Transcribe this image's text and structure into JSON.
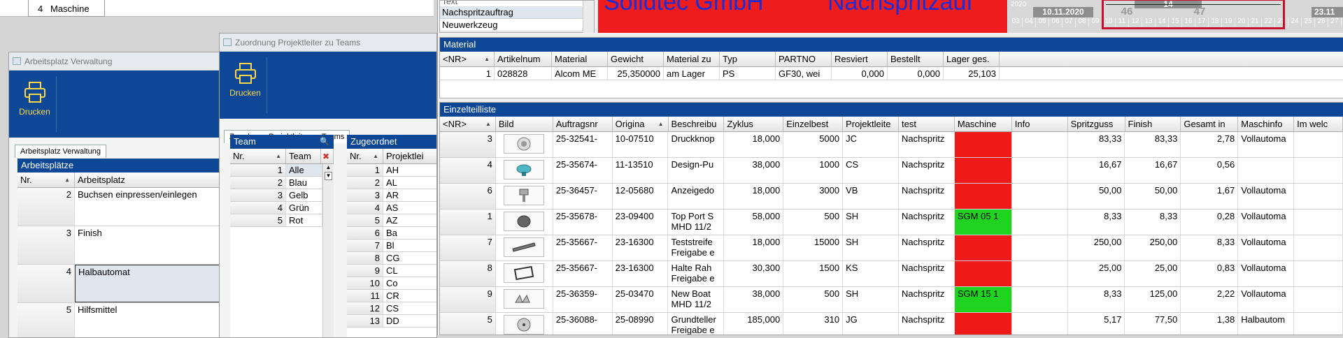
{
  "top_left": {
    "row_nr": "4",
    "row_label": "Maschine"
  },
  "win1": {
    "title": "Arbeitsplatz Verwaltung",
    "print_label": "Drucken",
    "tab": "Arbeitsplatz Verwaltung",
    "section": "Arbeitsplätze",
    "col_nr": "Nr.",
    "col_name": "Arbeitsplatz",
    "rows": [
      {
        "nr": "2",
        "name": "Buchsen einpressen/einlegen"
      },
      {
        "nr": "3",
        "name": "Finish"
      },
      {
        "nr": "4",
        "name": "Halbautomat"
      },
      {
        "nr": "5",
        "name": "Hilfsmittel"
      }
    ]
  },
  "win2": {
    "title": "Zuordnung Projektleiter zu Teams",
    "print_label": "Drucken",
    "tab": "Zuordnung Projektleiter zu Teams",
    "team_header": "Team",
    "assigned_header": "Zugeordnet",
    "col_nr": "Nr.",
    "col_team": "Team",
    "col_pl": "Projektlei",
    "teams": [
      {
        "nr": "1",
        "name": "Alle"
      },
      {
        "nr": "2",
        "name": "Blau"
      },
      {
        "nr": "3",
        "name": "Gelb"
      },
      {
        "nr": "4",
        "name": "Grün"
      },
      {
        "nr": "5",
        "name": "Rot"
      }
    ],
    "assigned": [
      {
        "nr": "1",
        "code": "AH"
      },
      {
        "nr": "2",
        "code": "AL"
      },
      {
        "nr": "3",
        "code": "AR"
      },
      {
        "nr": "4",
        "code": "AS"
      },
      {
        "nr": "5",
        "code": "AZ"
      },
      {
        "nr": "6",
        "code": "Ba"
      },
      {
        "nr": "7",
        "code": "Bl"
      },
      {
        "nr": "8",
        "code": "CG"
      },
      {
        "nr": "9",
        "code": "CL"
      },
      {
        "nr": "10",
        "code": "Co"
      },
      {
        "nr": "11",
        "code": "CR"
      },
      {
        "nr": "12",
        "code": "CS"
      },
      {
        "nr": "13",
        "code": "DD"
      }
    ]
  },
  "top": {
    "list_head": "Text",
    "list_items": [
      "Nachspritzauftrag",
      "Neuwerkzeug"
    ],
    "company": "Solidtec GmbH",
    "subject": "Nachspritzauf",
    "cal_year": "2020",
    "cal_date1": "10.11.2020",
    "cal_date2": "23.11",
    "cal_week1": "46",
    "cal_week2": "47",
    "cal_week_top": "14",
    "cal_days": [
      "03",
      "04",
      "05",
      "06",
      "07",
      "08",
      "09",
      "10",
      "11",
      "12",
      "13",
      "14",
      "15",
      "16",
      "17",
      "18",
      "19",
      "20",
      "21",
      "22",
      "23",
      "24",
      "25",
      "26",
      "27"
    ]
  },
  "material": {
    "title": "Material",
    "headers": [
      "<NR>",
      "Artikelnum",
      "Material",
      "Gewicht",
      "Material zu",
      "Typ",
      "PARTNO",
      "Resviert",
      "Bestellt",
      "Lager ges."
    ],
    "row": [
      "1",
      "028828",
      "Alcom ME",
      "25,350000",
      "am Lager",
      "PS",
      "GF30, wei",
      "0,000",
      "0,000",
      "25,103"
    ]
  },
  "parts": {
    "title": "Einzelteilliste",
    "headers": [
      "<NR>",
      "Bild",
      "Auftragsnr",
      "Origina",
      "Beschreibu",
      "Zyklus",
      "Einzelbest",
      "Projektleite",
      "test",
      "Maschine",
      "Info",
      "Spritzguss",
      "Finish",
      "Gesamt in",
      "Maschinfo",
      "Im welc"
    ],
    "rows": [
      {
        "nr": "3",
        "auftrag": "25-32541-",
        "orig": "10-07510",
        "desc1": "Druckknop",
        "desc2": "",
        "zyklus": "18,000",
        "einzel": "5000",
        "pl": "JC",
        "test": "Nachspritz",
        "maschine": "",
        "mcolor": "red",
        "spritz": "83,33",
        "finish": "83,33",
        "gesamt": "2,78",
        "minfo": "Vollautoma"
      },
      {
        "nr": "4",
        "auftrag": "25-35674-",
        "orig": "11-13510",
        "desc1": "Design-Pu",
        "desc2": "",
        "zyklus": "38,000",
        "einzel": "1000",
        "pl": "CS",
        "test": "Nachspritz",
        "maschine": "",
        "mcolor": "red",
        "spritz": "16,67",
        "finish": "16,67",
        "gesamt": "0,56",
        "minfo": ""
      },
      {
        "nr": "6",
        "auftrag": "25-36457-",
        "orig": "12-05680",
        "desc1": "Anzeigedo",
        "desc2": "",
        "zyklus": "18,000",
        "einzel": "3000",
        "pl": "VB",
        "test": "Nachspritz",
        "maschine": "",
        "mcolor": "red",
        "spritz": "50,00",
        "finish": "50,00",
        "gesamt": "1,67",
        "minfo": "Vollautoma"
      },
      {
        "nr": "1",
        "auftrag": "25-35678-",
        "orig": "23-09400",
        "desc1": "Top Port S",
        "desc2": "MHD 11/2",
        "zyklus": "58,000",
        "einzel": "500",
        "pl": "SH",
        "test": "Nachspritz",
        "maschine": "SGM 05  1",
        "mcolor": "green",
        "spritz": "8,33",
        "finish": "8,33",
        "gesamt": "0,28",
        "minfo": "Vollautoma"
      },
      {
        "nr": "7",
        "auftrag": "25-35667-",
        "orig": "23-16300",
        "desc1": "Teststreife",
        "desc2": "Freigabe e",
        "zyklus": "18,000",
        "einzel": "15000",
        "pl": "SH",
        "test": "Nachspritz",
        "maschine": "",
        "mcolor": "red",
        "spritz": "250,00",
        "finish": "250,00",
        "gesamt": "8,33",
        "minfo": "Vollautoma"
      },
      {
        "nr": "8",
        "auftrag": "25-35667-",
        "orig": "23-16300",
        "desc1": "Halte Rah",
        "desc2": "Freigabe e",
        "zyklus": "30,300",
        "einzel": "1500",
        "pl": "KS",
        "test": "Nachspritz",
        "maschine": "",
        "mcolor": "red",
        "spritz": "25,00",
        "finish": "25,00",
        "gesamt": "0,83",
        "minfo": "Vollautoma"
      },
      {
        "nr": "9",
        "auftrag": "25-36359-",
        "orig": "25-03470",
        "desc1": "New Boat",
        "desc2": "MHD 11/2",
        "zyklus": "38,000",
        "einzel": "500",
        "pl": "SH",
        "test": "Nachspritz",
        "maschine": "SGM 15  1",
        "mcolor": "green",
        "spritz": "8,33",
        "finish": "125,00",
        "gesamt": "2,22",
        "minfo": "Vollautoma"
      },
      {
        "nr": "5",
        "auftrag": "25-36088-",
        "orig": "25-08990",
        "desc1": "Grundteller",
        "desc2": "Freigabe e",
        "zyklus": "185,000",
        "einzel": "310",
        "pl": "JG",
        "test": "Nachspritz",
        "maschine": "",
        "mcolor": "red",
        "spritz": "5,17",
        "finish": "77,50",
        "gesamt": "1,38",
        "minfo": "Halbautom"
      }
    ]
  }
}
